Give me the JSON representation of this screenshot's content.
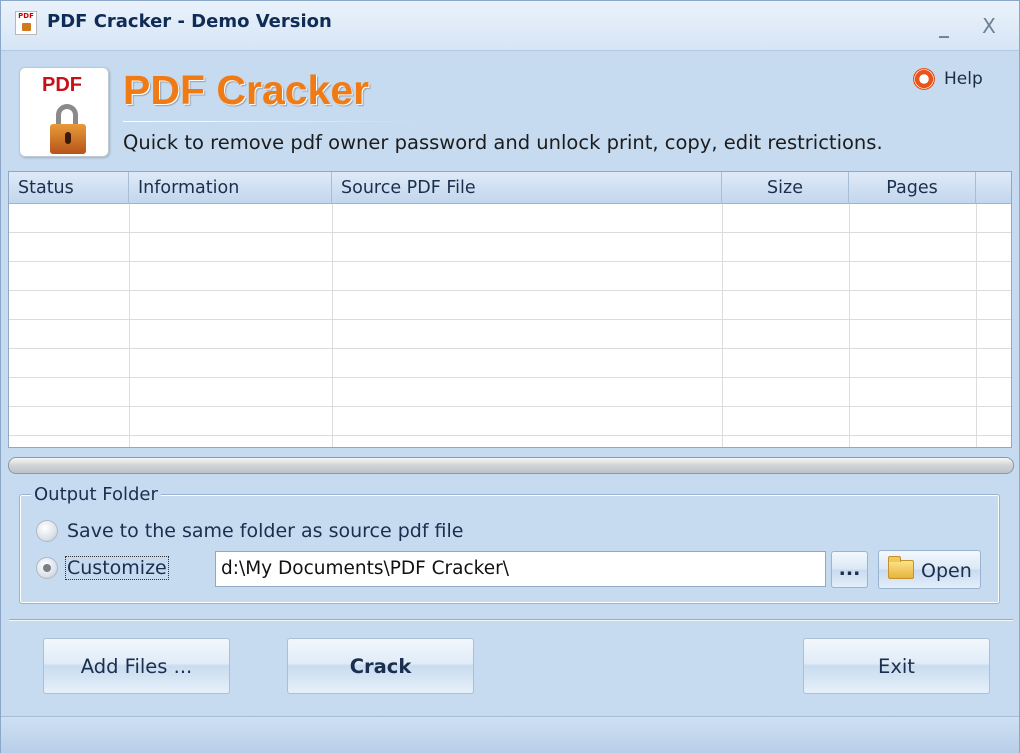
{
  "window": {
    "title": "PDF Cracker - Demo Version",
    "minimize": "_",
    "close": "X"
  },
  "header": {
    "logo_text": "PDF",
    "brand": "PDF Cracker",
    "tagline": "Quick to remove pdf owner password and unlock print, copy, edit restrictions.",
    "help_label": "Help"
  },
  "file_list": {
    "columns": [
      "Status",
      "Information",
      "Source PDF File",
      "Size",
      "Pages"
    ],
    "rows": []
  },
  "progress": {
    "value": 0
  },
  "output_folder": {
    "title": "Output Folder",
    "options": [
      {
        "label": "Save to the same folder as source pdf file",
        "selected": false
      },
      {
        "label": "Customize",
        "selected": true
      }
    ],
    "path": "d:\\My Documents\\PDF Cracker\\",
    "browse_label": "...",
    "open_label": "Open"
  },
  "actions": {
    "add_files": "Add Files ...",
    "crack": "Crack",
    "exit": "Exit"
  },
  "icons": {
    "app": "pdf-lock-icon",
    "help": "lifebuoy-icon",
    "open": "folder-icon"
  },
  "colors": {
    "brand": "#f07a14",
    "background": "#c6daf0",
    "logo_red": "#c8101a"
  }
}
